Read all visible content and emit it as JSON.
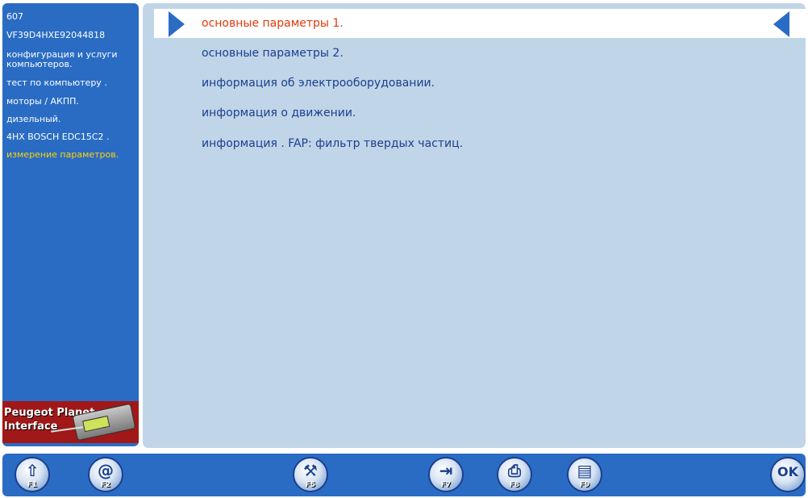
{
  "sidebar": {
    "items": [
      {
        "label": "607"
      },
      {
        "label": "VF39D4HXE92044818"
      },
      {
        "label": "конфигурация и услуги компьютеров."
      },
      {
        "label": "тест по компьютеру ."
      },
      {
        "label": "моторы /  АКПП."
      },
      {
        "label": "дизельный."
      },
      {
        "label": "4HX BOSCH EDC15C2 ."
      },
      {
        "label": "измерение параметров."
      }
    ],
    "active_color": "#ffd200",
    "brand": {
      "line1": "Peugeot Planet",
      "line2": "Interface"
    }
  },
  "menu": {
    "items": [
      {
        "label": "основные параметры 1."
      },
      {
        "label": "основные параметры 2."
      },
      {
        "label": "информация об электрооборудовании."
      },
      {
        "label": "информация о движении."
      },
      {
        "label": "информация . FAP: фильтр твердых частиц."
      }
    ],
    "selected_color": "#e03a0a",
    "item_color": "#1a3f8f"
  },
  "toolbar": {
    "keys": [
      {
        "fkey": "F1",
        "icon": "arrow-up-icon",
        "glyph": "⇧"
      },
      {
        "fkey": "F2",
        "icon": "at-icon",
        "glyph": "@"
      },
      {
        "fkey": "F5",
        "icon": "tools-icon",
        "glyph": "⚒"
      },
      {
        "fkey": "F7",
        "icon": "exit-icon",
        "glyph": "⇥"
      },
      {
        "fkey": "F8",
        "icon": "printer-icon",
        "glyph": "⎙"
      },
      {
        "fkey": "F9",
        "icon": "document-icon",
        "glyph": "▤"
      },
      {
        "fkey": "OK",
        "icon": "ok-enter-icon",
        "glyph": "OK"
      }
    ]
  },
  "colors": {
    "accent": "#2a6cc4",
    "panel": "#c1d5e8"
  }
}
